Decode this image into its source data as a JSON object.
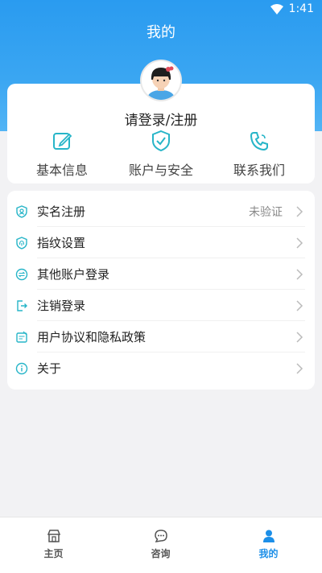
{
  "status_bar": {
    "time": "1:41"
  },
  "header": {
    "title": "我的"
  },
  "profile": {
    "login_label": "请登录/注册"
  },
  "quick_actions": [
    {
      "label": "基本信息",
      "icon": "edit-icon"
    },
    {
      "label": "账户与安全",
      "icon": "shield-check-icon"
    },
    {
      "label": "联系我们",
      "icon": "phone-icon"
    }
  ],
  "menu": [
    {
      "label": "实名注册",
      "value": "未验证",
      "icon": "id-shield-icon"
    },
    {
      "label": "指纹设置",
      "value": "",
      "icon": "fingerprint-shield-icon"
    },
    {
      "label": "其他账户登录",
      "value": "",
      "icon": "switch-account-icon"
    },
    {
      "label": "注销登录",
      "value": "",
      "icon": "logout-icon"
    },
    {
      "label": "用户协议和隐私政策",
      "value": "",
      "icon": "agreement-icon"
    },
    {
      "label": "关于",
      "value": "",
      "icon": "info-icon"
    }
  ],
  "tabbar": [
    {
      "label": "主页",
      "icon": "home-icon",
      "active": false
    },
    {
      "label": "咨询",
      "icon": "chat-icon",
      "active": false
    },
    {
      "label": "我的",
      "icon": "person-icon",
      "active": true
    }
  ],
  "colors": {
    "accent": "#1c8fe8",
    "header": "#2a9bf0",
    "icon_teal": "#27b5c8"
  }
}
